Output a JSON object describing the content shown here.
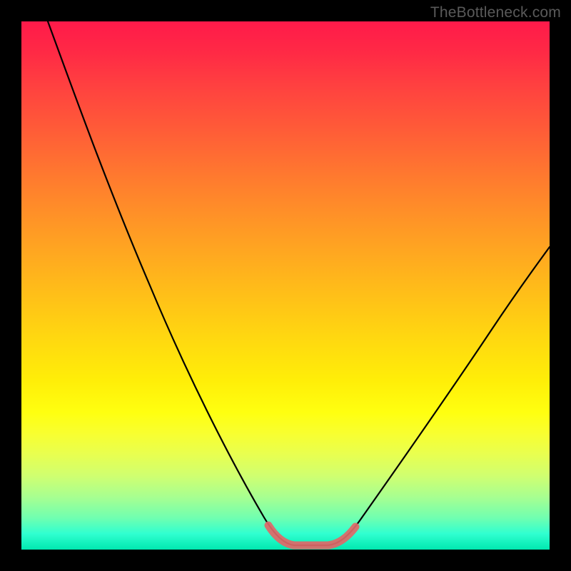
{
  "watermark": "TheBottleneck.com",
  "chart_data": {
    "type": "line",
    "title": "",
    "xlabel": "",
    "ylabel": "",
    "x_range": [
      0,
      100
    ],
    "y_range": [
      0,
      100
    ],
    "series": [
      {
        "name": "curve",
        "color": "#000000",
        "points": [
          {
            "x": 5,
            "y": 100
          },
          {
            "x": 12,
            "y": 82
          },
          {
            "x": 20,
            "y": 62
          },
          {
            "x": 28,
            "y": 44
          },
          {
            "x": 36,
            "y": 26
          },
          {
            "x": 44,
            "y": 10
          },
          {
            "x": 48,
            "y": 3
          },
          {
            "x": 52,
            "y": 0.5
          },
          {
            "x": 58,
            "y": 0.5
          },
          {
            "x": 62,
            "y": 2
          },
          {
            "x": 66,
            "y": 6
          },
          {
            "x": 74,
            "y": 18
          },
          {
            "x": 82,
            "y": 30
          },
          {
            "x": 90,
            "y": 42
          },
          {
            "x": 100,
            "y": 56
          }
        ]
      },
      {
        "name": "bottom-highlight",
        "color": "#e46a6a",
        "points": [
          {
            "x": 47,
            "y": 4
          },
          {
            "x": 50,
            "y": 1
          },
          {
            "x": 54,
            "y": 0.5
          },
          {
            "x": 58,
            "y": 0.5
          },
          {
            "x": 61,
            "y": 2
          },
          {
            "x": 63,
            "y": 4
          }
        ]
      }
    ],
    "background_gradient": {
      "top_color": "#ff1a4a",
      "bottom_color": "#00e8b0",
      "type": "vertical",
      "description": "red-orange-yellow-green heat gradient"
    }
  }
}
